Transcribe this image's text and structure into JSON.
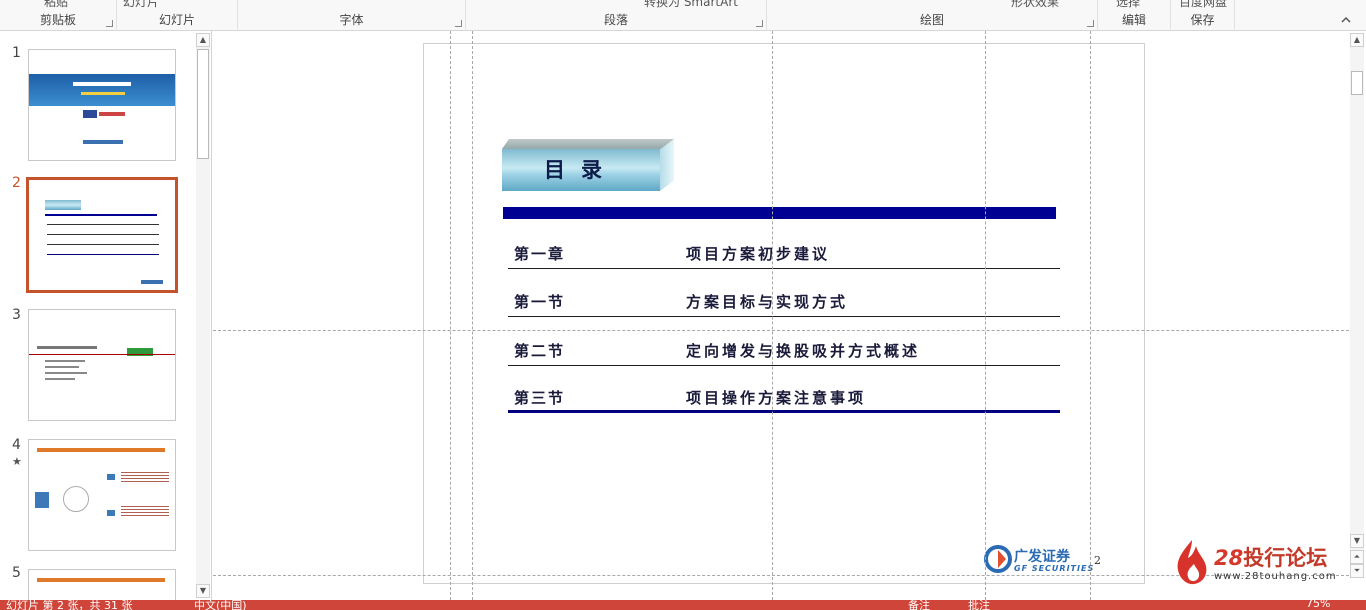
{
  "ribbon": {
    "groups": {
      "clipboard": "剪贴板",
      "slides": "幻灯片",
      "font": "字体",
      "paragraph": "段落",
      "drawing": "绘图",
      "editing": "编辑",
      "save": "保存"
    },
    "cut_texts": {
      "paste": "粘贴",
      "new_slide": "幻灯片",
      "smartart": "转换为 SmartArt",
      "shape_effects": "形状效果",
      "select": "选择",
      "baidu": "百度网盘"
    }
  },
  "thumbnails": [
    {
      "number": "1",
      "selected": false,
      "star": ""
    },
    {
      "number": "2",
      "selected": true,
      "star": ""
    },
    {
      "number": "3",
      "selected": false,
      "star": ""
    },
    {
      "number": "4",
      "selected": false,
      "star": "★"
    },
    {
      "number": "5",
      "selected": false,
      "star": ""
    }
  ],
  "slide": {
    "title": "目录",
    "toc": [
      {
        "chapter": "第一章",
        "title": "项目方案初步建议"
      },
      {
        "chapter": "第一节",
        "title": "方案目标与实现方式"
      },
      {
        "chapter": "第二节",
        "title": "定向增发与换股吸并方式概述"
      },
      {
        "chapter": "第三节",
        "title": "项目操作方案注意事项"
      }
    ],
    "logo_cn": "广发证券",
    "logo_en": "GF SECURITIES",
    "page_number": "2"
  },
  "watermark": {
    "number": "28",
    "name": "投行论坛",
    "url": "www.28touhang.com"
  },
  "status": {
    "slide_info": "幻灯片 第 2 张，共 31 张",
    "language": "中文(中国)",
    "notes": "备注",
    "comments": "批注",
    "zoom": "75%"
  },
  "colors": {
    "accent": "#c4522b",
    "status_bar": "#d0453a",
    "toc_bar": "#000093"
  }
}
